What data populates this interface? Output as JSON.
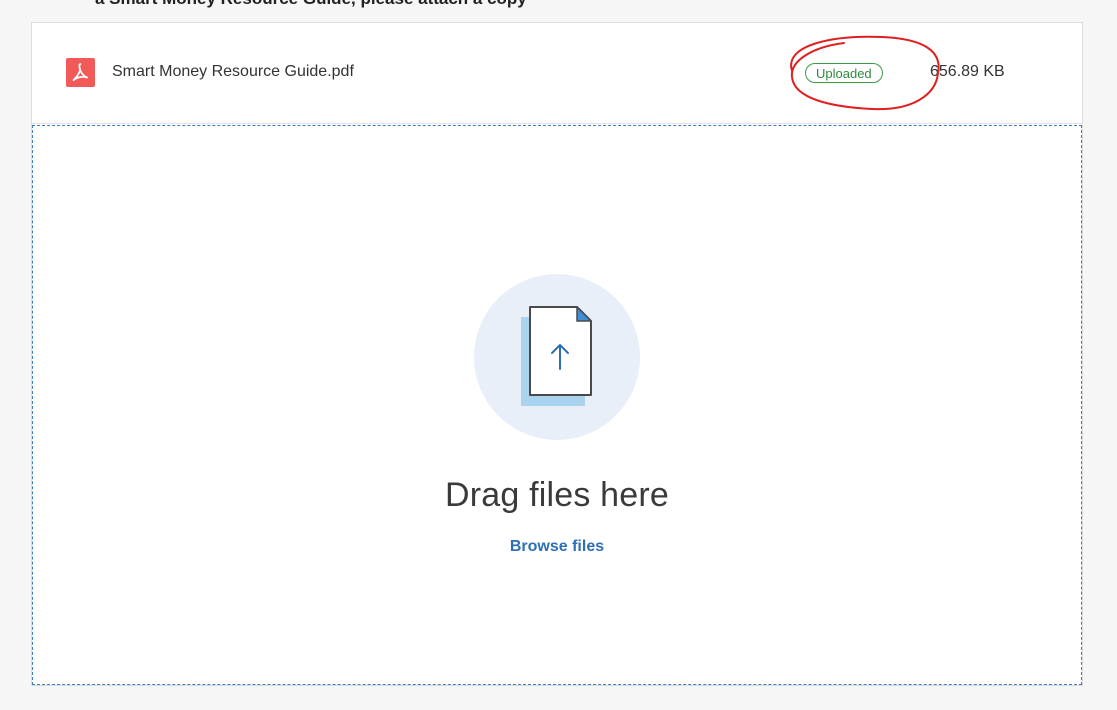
{
  "header": {
    "partial_text": "a Smart Money Resource Guide, please attach a copy"
  },
  "file": {
    "icon": "pdf-file-icon",
    "name": "Smart Money Resource Guide.pdf",
    "status": "Uploaded",
    "size": "656.89 KB"
  },
  "dropzone": {
    "icon": "upload-file-icon",
    "title": "Drag files here",
    "browse_label": "Browse files"
  },
  "colors": {
    "pdf_red": "#f25a5a",
    "status_green": "#3d9b47",
    "link_blue": "#2e6fb5",
    "annotation_red": "#e02020"
  }
}
